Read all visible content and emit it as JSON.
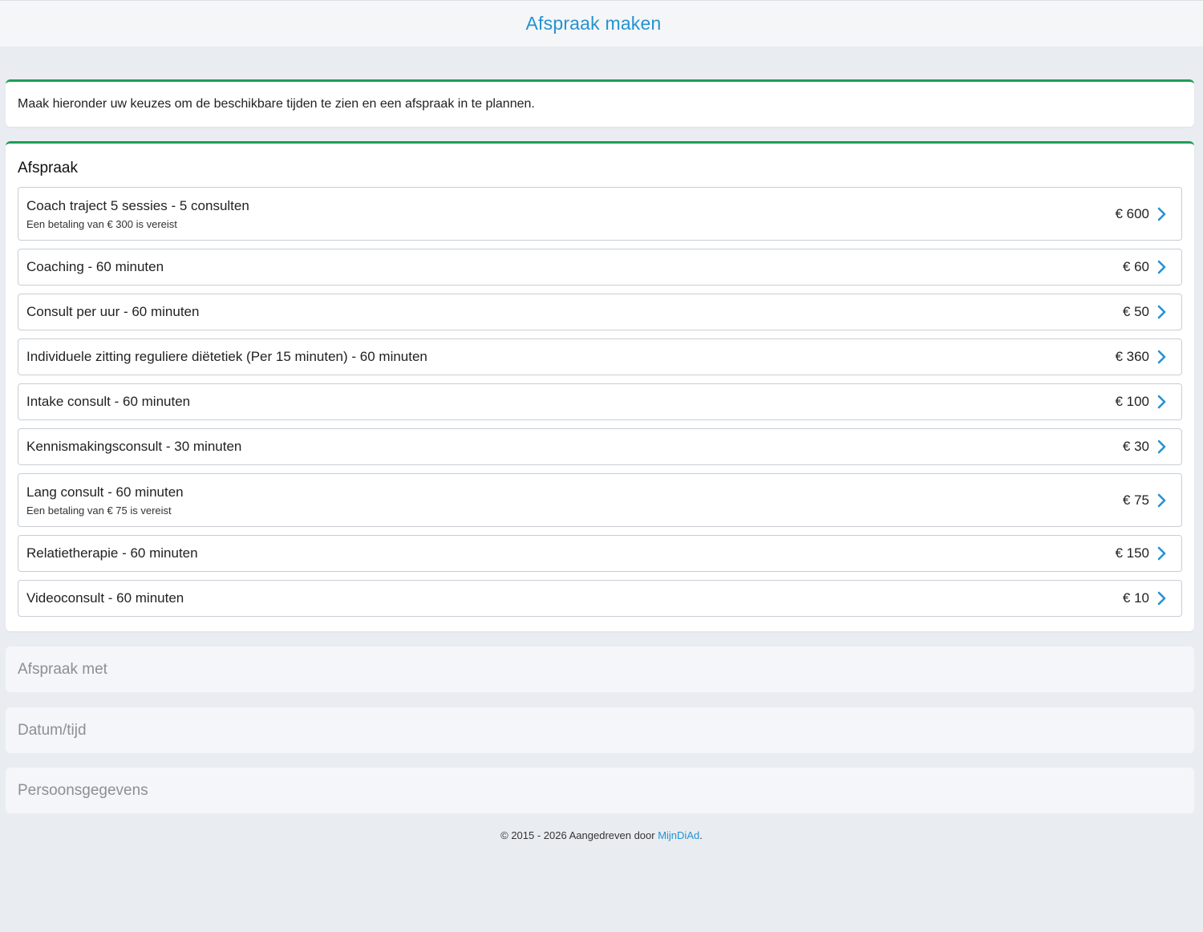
{
  "header": {
    "title": "Afspraak maken"
  },
  "intro": {
    "text": "Maak hieronder uw keuzes om de beschikbare tijden te zien en een afspraak in te plannen."
  },
  "appointment": {
    "heading": "Afspraak",
    "options": [
      {
        "name": "Coach traject 5 sessies - 5 consulten",
        "note": "Een betaling van € 300 is vereist",
        "price": "€ 600"
      },
      {
        "name": "Coaching - 60 minuten",
        "note": "",
        "price": "€ 60"
      },
      {
        "name": "Consult per uur - 60 minuten",
        "note": "",
        "price": "€ 50"
      },
      {
        "name": "Individuele zitting reguliere diëtetiek (Per 15 minuten) - 60 minuten",
        "note": "",
        "price": "€ 360"
      },
      {
        "name": "Intake consult - 60 minuten",
        "note": "",
        "price": "€ 100"
      },
      {
        "name": "Kennismakingsconsult - 30 minuten",
        "note": "",
        "price": "€ 30"
      },
      {
        "name": "Lang consult - 60 minuten",
        "note": "Een betaling van € 75 is vereist",
        "price": "€ 75"
      },
      {
        "name": "Relatietherapie - 60 minuten",
        "note": "",
        "price": "€ 150"
      },
      {
        "name": "Videoconsult - 60 minuten",
        "note": "",
        "price": "€ 10"
      }
    ],
    "chevron_icon": "chevron-right-icon"
  },
  "sections": {
    "with": "Afspraak met",
    "datetime": "Datum/tijd",
    "personal": "Persoonsgegevens"
  },
  "footer": {
    "text": "© 2015 - 2026 Aangedreven door ",
    "link": "MijnDiAd",
    "suffix": "."
  },
  "colors": {
    "accent": "#2493d1",
    "card_border": "#1f9d55",
    "background": "#e9edf2"
  }
}
